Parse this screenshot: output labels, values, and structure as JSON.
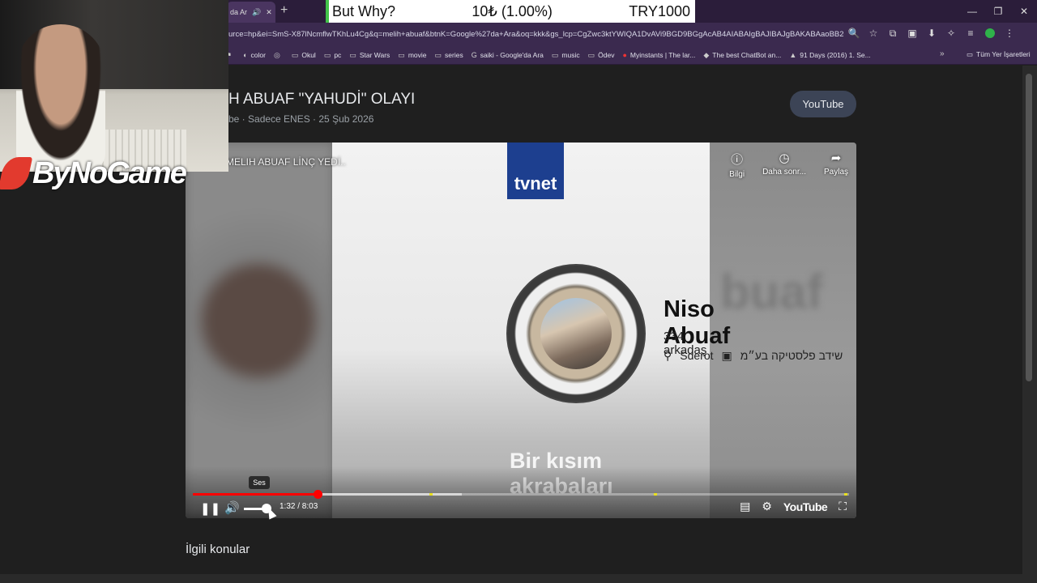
{
  "browser": {
    "active_tab_title": "da Ar",
    "url": "urce=hp&ei=SmS-X87lNcmflwTKhLu4Cg&q=melih+abuaf&btnK=Google%27da+Ara&oq=kkk&gs_lcp=CgZwc3ktYWIQA1DvAVi9BGD9BGgAcAB4AIABAIgBAJIBAJgBAKABAaoBB2d3c...",
    "bookmarks": [
      {
        "icon": "flag-icon",
        "label": ""
      },
      {
        "icon": "color-icon",
        "label": "color"
      },
      {
        "icon": "globe-icon",
        "label": ""
      },
      {
        "icon": "folder-icon",
        "label": "Okul"
      },
      {
        "icon": "folder-icon",
        "label": "pc"
      },
      {
        "icon": "folder-icon",
        "label": "Star Wars"
      },
      {
        "icon": "folder-icon",
        "label": "movie"
      },
      {
        "icon": "folder-icon",
        "label": "series"
      },
      {
        "icon": "google-icon",
        "label": "saiki - Google'da Ara"
      },
      {
        "icon": "folder-icon",
        "label": "music"
      },
      {
        "icon": "folder-icon",
        "label": "Ödev"
      },
      {
        "icon": "site-icon",
        "label": "Myinstants | The lar..."
      },
      {
        "icon": "chatbot-icon",
        "label": "The best ChatBot an..."
      },
      {
        "icon": "site-icon",
        "label": "91 Days (2016) 1. Se..."
      }
    ],
    "all_bookmarks": "Tüm Yer İşaretleri"
  },
  "donation": {
    "message": "But Why?",
    "amount": "10₺ (1.00%)",
    "goal": "TRY1000"
  },
  "video": {
    "title": "H ABUAF \"YAHUDİ\" OLAYI",
    "meta": "be · Sadece ENES · 25 Şub 2026",
    "source_button": "YouTube",
    "player_title": "MELIH ABUAF LİNÇ YEDİ..",
    "actions": [
      {
        "icon": "info-icon",
        "label": "Bilgi"
      },
      {
        "icon": "clock-icon",
        "label": "Daha sonr..."
      },
      {
        "icon": "share-icon",
        "label": "Paylaş"
      }
    ],
    "frame": {
      "channel_logo": "tvnet",
      "profile_name": "Niso Abuaf",
      "profile_friends": "334 arkadaş",
      "profile_location": "Sderot",
      "profile_work": "שידב פלסטיקה בע״מ",
      "subtitle": "Bir kısım akrabaları",
      "blur_text": "buaf"
    },
    "time": "1:32 / 8:03",
    "progress_played": 0.19,
    "progress_buffered": 0.41,
    "volume": 1.0,
    "tooltip": "Ses",
    "yt_logo": "YouTube"
  },
  "related": "İlgili konular",
  "overlay": {
    "brand": "ByNoGame"
  },
  "colors": {
    "accent_red": "#ff0000",
    "tab_bg": "#2b1d3a",
    "toolbar_bg": "#3b2a4f",
    "page_bg": "#1f1f1f",
    "pill_bg": "#3c4456"
  }
}
